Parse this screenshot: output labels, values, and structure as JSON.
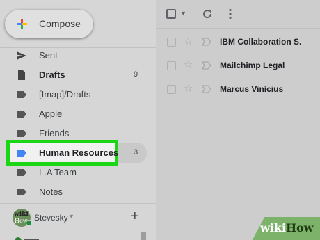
{
  "compose": {
    "label": "Compose"
  },
  "nav": [
    {
      "key": "sent",
      "label": "Sent",
      "count": "",
      "icon": "send-icon",
      "bold": false
    },
    {
      "key": "drafts",
      "label": "Drafts",
      "count": "9",
      "icon": "draft-file-icon",
      "bold": true
    },
    {
      "key": "imap-drafts",
      "label": "[Imap]/Drafts",
      "count": "",
      "icon": "label-icon",
      "bold": false
    },
    {
      "key": "apple",
      "label": "Apple",
      "count": "",
      "icon": "label-icon",
      "bold": false
    },
    {
      "key": "friends",
      "label": "Friends",
      "count": "",
      "icon": "label-icon",
      "bold": false
    },
    {
      "key": "human-resources",
      "label": "Human Resources",
      "count": "3",
      "icon": "label-icon",
      "bold": true
    },
    {
      "key": "la-team",
      "label": "L.A Team",
      "count": "",
      "icon": "label-icon",
      "bold": false
    },
    {
      "key": "notes",
      "label": "Notes",
      "count": "",
      "icon": "label-icon",
      "bold": false
    }
  ],
  "user": {
    "name": "Stevesky",
    "avatar_text": "wiki",
    "avatar_text2": "How"
  },
  "emails": [
    {
      "sender": "IBM Collaboration S."
    },
    {
      "sender": "Mailchimp Legal"
    },
    {
      "sender": "Marcus Vinícius"
    }
  ],
  "watermark": {
    "wiki": "wiki",
    "how": "How"
  },
  "colors": {
    "highlight_border": "#1bd614",
    "human_resources_label": "#4285f4",
    "sidebar_bg": "#d6d6d6",
    "main_bg": "#cdcdcd",
    "watermark_bg": "#7cb26a"
  }
}
